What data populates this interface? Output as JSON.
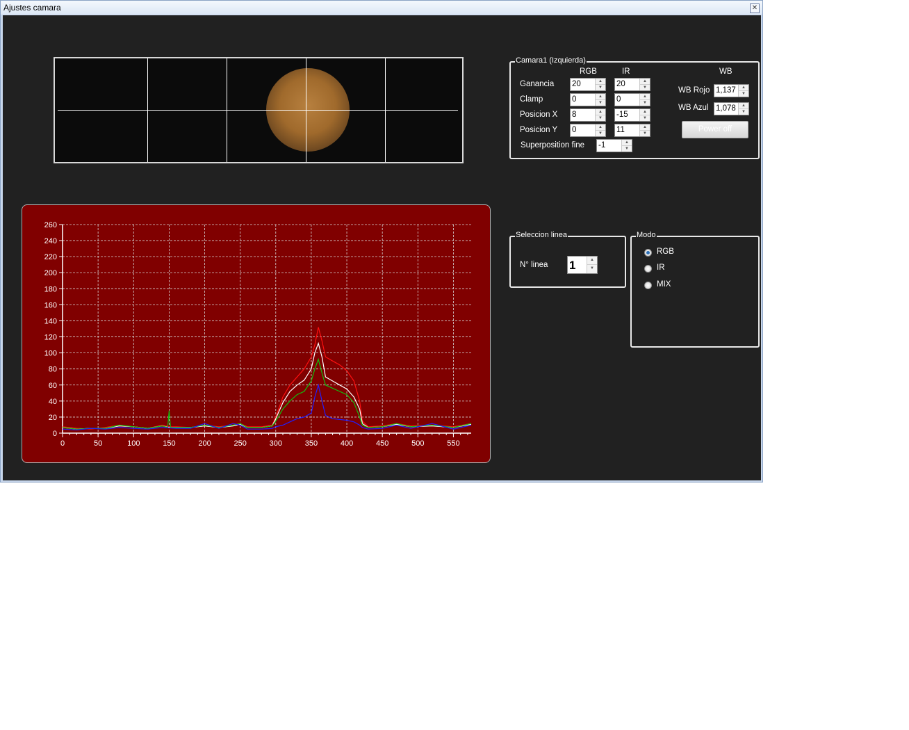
{
  "window": {
    "title": "Ajustes camara"
  },
  "camera_group": {
    "title": "Camara1 (Izquierda)",
    "col_rgb": "RGB",
    "col_ir": "IR",
    "col_wb": "WB",
    "rows": [
      {
        "label": "Ganancia",
        "rgb": "20",
        "ir": "20"
      },
      {
        "label": "Clamp",
        "rgb": "0",
        "ir": "0"
      },
      {
        "label": "Posicion X",
        "rgb": "8",
        "ir": "-15"
      },
      {
        "label": "Posicion Y",
        "rgb": "0",
        "ir": "11"
      }
    ],
    "superposition": {
      "label": "Superposition fine",
      "value": "-1"
    },
    "wb_rojo": {
      "label": "WB Rojo",
      "value": "1,137"
    },
    "wb_azul": {
      "label": "WB Azul",
      "value": "1,078"
    },
    "power_button": "Power off"
  },
  "line_group": {
    "title": "Seleccion linea",
    "label": "N° linea",
    "value": "1"
  },
  "mode_group": {
    "title": "Modo",
    "options": [
      "RGB",
      "IR",
      "MIX"
    ],
    "selected": "RGB"
  },
  "colors": {
    "chart_bg": "#800000",
    "window_bg": "#212121",
    "red": "#ff1010",
    "green": "#10c010",
    "blue": "#2020ff",
    "white": "#ffffff"
  },
  "chart_data": {
    "type": "line",
    "xlim": [
      0,
      575
    ],
    "ylim": [
      0,
      260
    ],
    "x_ticks": [
      0,
      50,
      100,
      150,
      200,
      250,
      300,
      350,
      400,
      450,
      500,
      550
    ],
    "y_ticks": [
      0,
      20,
      40,
      60,
      80,
      100,
      120,
      140,
      160,
      180,
      200,
      220,
      240,
      260
    ],
    "grid": true,
    "series": [
      {
        "color": "red",
        "points": [
          [
            0,
            8
          ],
          [
            20,
            6
          ],
          [
            40,
            5
          ],
          [
            60,
            7
          ],
          [
            80,
            10
          ],
          [
            100,
            8
          ],
          [
            120,
            6
          ],
          [
            140,
            10
          ],
          [
            150,
            8
          ],
          [
            160,
            8
          ],
          [
            180,
            7
          ],
          [
            200,
            10
          ],
          [
            220,
            8
          ],
          [
            240,
            10
          ],
          [
            250,
            12
          ],
          [
            260,
            8
          ],
          [
            280,
            8
          ],
          [
            295,
            10
          ],
          [
            300,
            20
          ],
          [
            310,
            45
          ],
          [
            320,
            60
          ],
          [
            330,
            70
          ],
          [
            340,
            80
          ],
          [
            350,
            95
          ],
          [
            355,
            110
          ],
          [
            360,
            132
          ],
          [
            365,
            115
          ],
          [
            370,
            95
          ],
          [
            380,
            90
          ],
          [
            390,
            85
          ],
          [
            400,
            78
          ],
          [
            410,
            65
          ],
          [
            418,
            40
          ],
          [
            422,
            15
          ],
          [
            430,
            8
          ],
          [
            450,
            9
          ],
          [
            470,
            12
          ],
          [
            490,
            9
          ],
          [
            520,
            10
          ],
          [
            550,
            8
          ],
          [
            575,
            12
          ]
        ]
      },
      {
        "color": "white",
        "points": [
          [
            0,
            7
          ],
          [
            20,
            5
          ],
          [
            40,
            6
          ],
          [
            60,
            6
          ],
          [
            80,
            9
          ],
          [
            100,
            8
          ],
          [
            120,
            6
          ],
          [
            140,
            9
          ],
          [
            150,
            7
          ],
          [
            160,
            7
          ],
          [
            180,
            7
          ],
          [
            200,
            9
          ],
          [
            220,
            7
          ],
          [
            240,
            9
          ],
          [
            250,
            11
          ],
          [
            260,
            7
          ],
          [
            280,
            7
          ],
          [
            295,
            9
          ],
          [
            300,
            18
          ],
          [
            310,
            38
          ],
          [
            320,
            52
          ],
          [
            330,
            60
          ],
          [
            340,
            66
          ],
          [
            350,
            80
          ],
          [
            355,
            100
          ],
          [
            360,
            112
          ],
          [
            365,
            95
          ],
          [
            370,
            70
          ],
          [
            380,
            65
          ],
          [
            390,
            60
          ],
          [
            400,
            55
          ],
          [
            410,
            45
          ],
          [
            418,
            30
          ],
          [
            422,
            12
          ],
          [
            430,
            7
          ],
          [
            450,
            8
          ],
          [
            470,
            11
          ],
          [
            490,
            8
          ],
          [
            520,
            9
          ],
          [
            550,
            7
          ],
          [
            575,
            11
          ]
        ]
      },
      {
        "color": "green",
        "points": [
          [
            0,
            7
          ],
          [
            20,
            5
          ],
          [
            40,
            6
          ],
          [
            60,
            6
          ],
          [
            80,
            10
          ],
          [
            100,
            8
          ],
          [
            120,
            6
          ],
          [
            140,
            9
          ],
          [
            148,
            7
          ],
          [
            150,
            28
          ],
          [
            152,
            7
          ],
          [
            160,
            7
          ],
          [
            180,
            7
          ],
          [
            200,
            10
          ],
          [
            220,
            7
          ],
          [
            240,
            10
          ],
          [
            250,
            12
          ],
          [
            260,
            7
          ],
          [
            280,
            7
          ],
          [
            295,
            9
          ],
          [
            300,
            15
          ],
          [
            310,
            30
          ],
          [
            320,
            40
          ],
          [
            330,
            48
          ],
          [
            340,
            52
          ],
          [
            350,
            65
          ],
          [
            355,
            80
          ],
          [
            360,
            92
          ],
          [
            365,
            75
          ],
          [
            370,
            60
          ],
          [
            380,
            56
          ],
          [
            390,
            52
          ],
          [
            400,
            48
          ],
          [
            410,
            38
          ],
          [
            418,
            20
          ],
          [
            422,
            10
          ],
          [
            430,
            7
          ],
          [
            450,
            8
          ],
          [
            470,
            12
          ],
          [
            490,
            8
          ],
          [
            520,
            10
          ],
          [
            550,
            7
          ],
          [
            575,
            12
          ]
        ]
      },
      {
        "color": "blue",
        "points": [
          [
            0,
            5
          ],
          [
            20,
            4
          ],
          [
            40,
            6
          ],
          [
            60,
            5
          ],
          [
            80,
            7
          ],
          [
            100,
            6
          ],
          [
            120,
            5
          ],
          [
            140,
            7
          ],
          [
            160,
            6
          ],
          [
            180,
            6
          ],
          [
            200,
            12
          ],
          [
            220,
            6
          ],
          [
            240,
            12
          ],
          [
            250,
            10
          ],
          [
            260,
            5
          ],
          [
            280,
            5
          ],
          [
            295,
            6
          ],
          [
            300,
            8
          ],
          [
            310,
            10
          ],
          [
            320,
            14
          ],
          [
            330,
            18
          ],
          [
            340,
            20
          ],
          [
            350,
            25
          ],
          [
            355,
            45
          ],
          [
            360,
            60
          ],
          [
            365,
            40
          ],
          [
            370,
            22
          ],
          [
            380,
            18
          ],
          [
            390,
            17
          ],
          [
            400,
            16
          ],
          [
            410,
            14
          ],
          [
            418,
            10
          ],
          [
            422,
            7
          ],
          [
            430,
            5
          ],
          [
            450,
            6
          ],
          [
            470,
            10
          ],
          [
            490,
            6
          ],
          [
            520,
            12
          ],
          [
            550,
            5
          ],
          [
            575,
            10
          ]
        ]
      }
    ]
  }
}
